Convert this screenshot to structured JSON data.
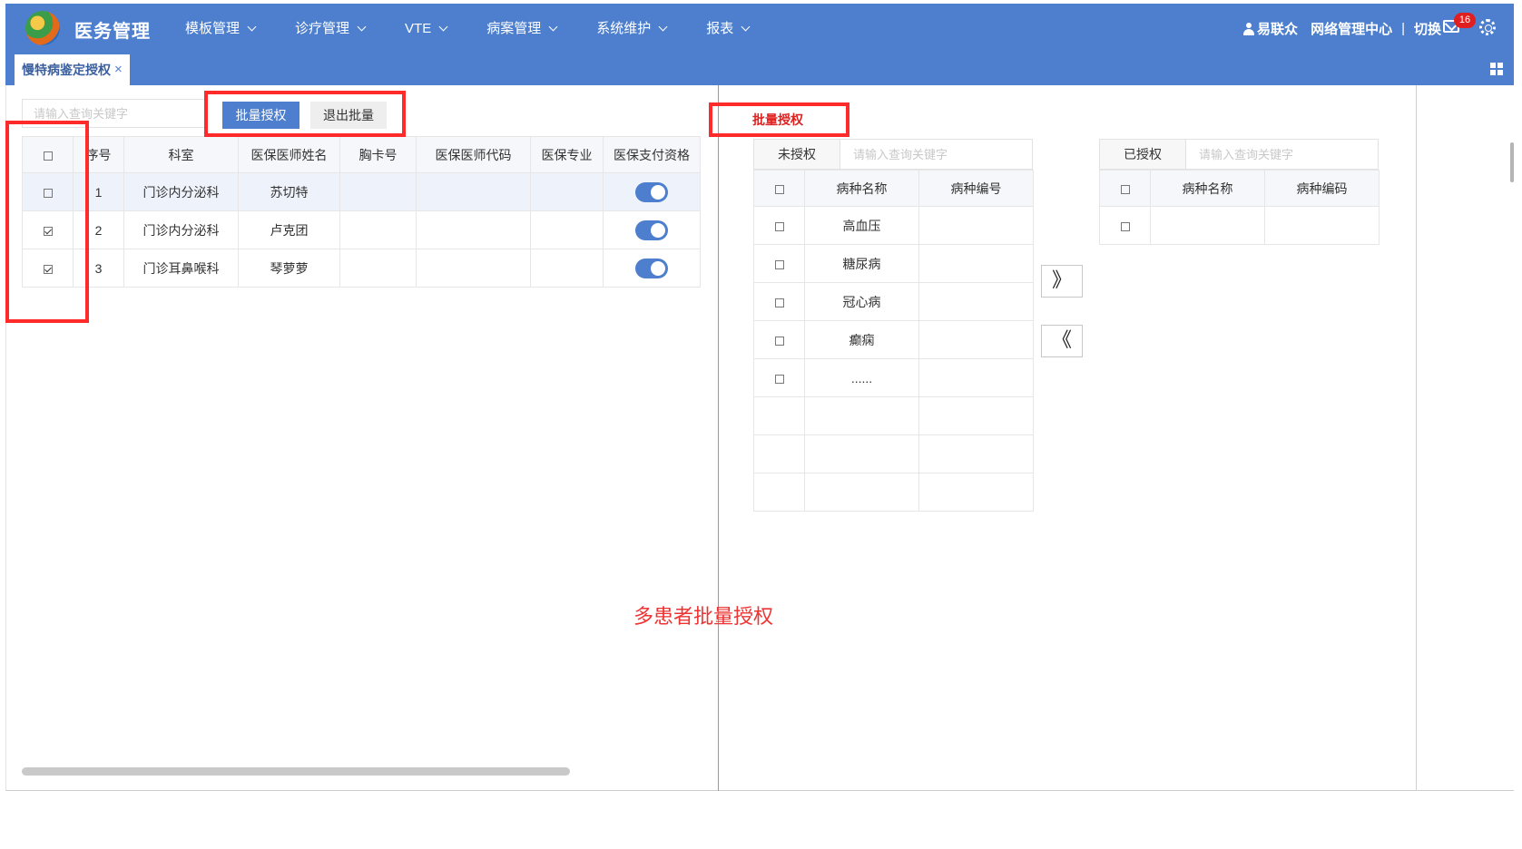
{
  "header": {
    "brand": "医务管理",
    "nav": [
      {
        "label": "模板管理"
      },
      {
        "label": "诊疗管理"
      },
      {
        "label": "VTE"
      },
      {
        "label": "病案管理"
      },
      {
        "label": "系统维护"
      },
      {
        "label": "报表"
      }
    ],
    "user_name": "易联众",
    "org": "网络管理中心",
    "divider": "|",
    "switch_label": "切换",
    "mail_count": "16"
  },
  "tabs": [
    {
      "label": "慢特病鉴定授权",
      "close": "×"
    }
  ],
  "left": {
    "search_placeholder": "请输入查询关键字",
    "batch_auth_label": "批量授权",
    "exit_batch_label": "退出批量",
    "columns": [
      "",
      "序号",
      "科室",
      "医保医师姓名",
      "胸卡号",
      "医保医师代码",
      "医保专业",
      "医保支付资格"
    ],
    "rows": [
      {
        "checked": false,
        "no": "1",
        "dept": "门诊内分泌科",
        "name": "苏切特",
        "badge_no": "",
        "code": "",
        "major": "",
        "pay_on": true
      },
      {
        "checked": true,
        "no": "2",
        "dept": "门诊内分泌科",
        "name": "卢克团",
        "badge_no": "",
        "code": "",
        "major": "",
        "pay_on": true
      },
      {
        "checked": true,
        "no": "3",
        "dept": "门诊耳鼻喉科",
        "name": "琴萝萝",
        "badge_no": "",
        "code": "",
        "major": "",
        "pay_on": true
      }
    ]
  },
  "right": {
    "section_title": "批量授权",
    "unauthorized": {
      "label": "未授权",
      "search_placeholder": "请输入查询关键字",
      "columns": [
        "",
        "病种名称",
        "病种编号"
      ],
      "rows": [
        {
          "name": "高血压",
          "code": ""
        },
        {
          "name": "糖尿病",
          "code": ""
        },
        {
          "name": "冠心病",
          "code": ""
        },
        {
          "name": "癫痫",
          "code": ""
        },
        {
          "name": "......",
          "code": ""
        }
      ],
      "empty_rows": 3
    },
    "move_right": "》",
    "move_left": "《",
    "authorized": {
      "label": "已授权",
      "search_placeholder": "请输入查询关键字",
      "columns": [
        "",
        "病种名称",
        "病种编码"
      ]
    }
  },
  "annotation": {
    "caption": "多患者批量授权",
    "highlight_color": "#ff2b2b"
  },
  "colors": {
    "primary": "#4d7fce",
    "badge": "#e02020"
  }
}
